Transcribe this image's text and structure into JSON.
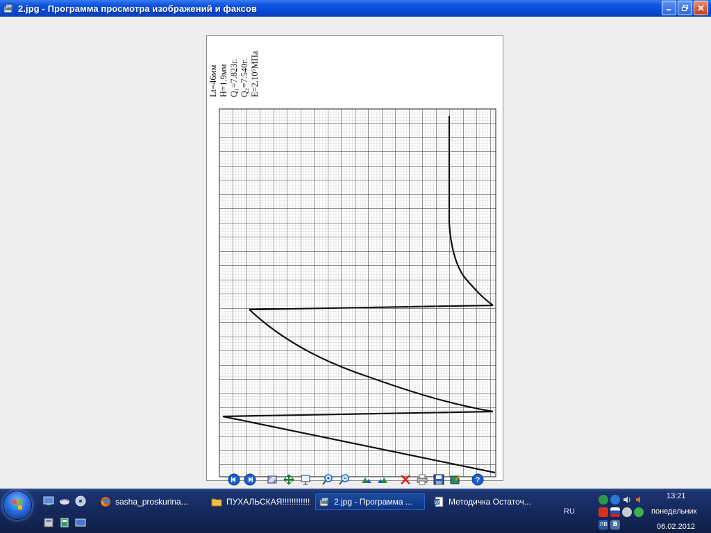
{
  "window": {
    "title": "2.jpg - Программа просмотра изображений и факсов"
  },
  "image": {
    "params": [
      "Lt=46мм",
      "H=1.9мм",
      "Q₁=7.823г.",
      "Q₂=7.540г.",
      "E=2.10⁵МПа"
    ]
  },
  "toolbar": {
    "buttons": [
      "previous-image",
      "next-image",
      "best-fit",
      "actual-size",
      "slideshow",
      "zoom-in",
      "zoom-out",
      "rotate-clockwise",
      "rotate-counterclockwise",
      "delete",
      "print",
      "save-copy",
      "open-in-editor",
      "help"
    ]
  },
  "taskbar": {
    "tasks": [
      {
        "label": "sasha_proskurina...",
        "icon": "firefox-icon"
      },
      {
        "label": "ПУХАЛЬСКАЯ!!!!!!!!!!!!",
        "icon": "folder-icon"
      },
      {
        "label": "2.jpg - Программа ...",
        "icon": "image-viewer-icon"
      },
      {
        "label": "Методичка Остаточ...",
        "icon": "word-document-icon"
      }
    ],
    "language": "RU",
    "clock": {
      "time": "13:21",
      "day": "понедельник",
      "date": "06.02.2012"
    }
  }
}
